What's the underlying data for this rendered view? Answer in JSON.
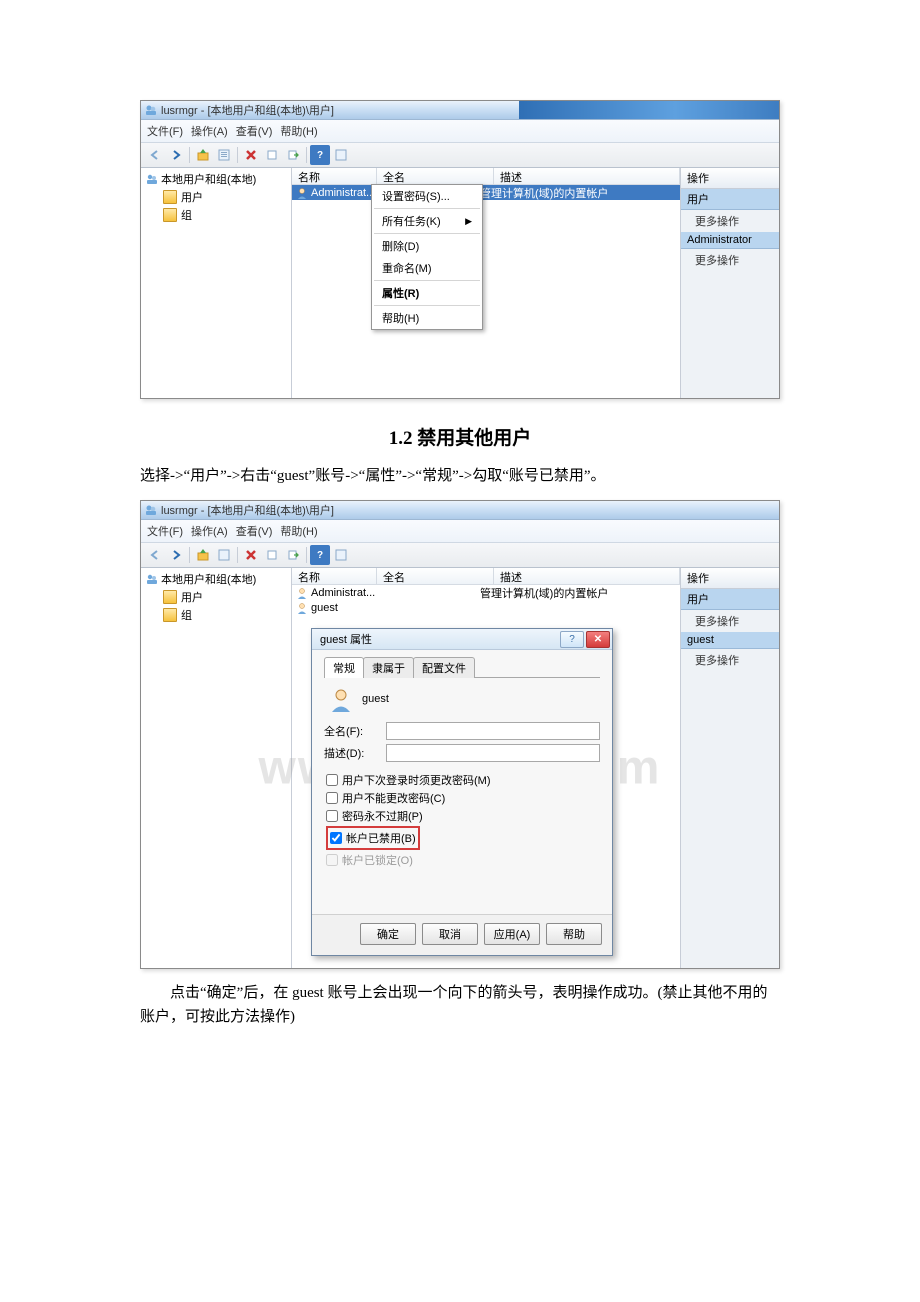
{
  "win": {
    "title": "lusrmgr - [本地用户和组(本地)\\用户]",
    "menu": {
      "file": "文件(F)",
      "action": "操作(A)",
      "view": "查看(V)",
      "help": "帮助(H)"
    },
    "tree": {
      "root": "本地用户和组(本地)",
      "users": "用户",
      "groups": "组"
    },
    "cols": {
      "name": "名称",
      "fullname": "全名",
      "desc": "描述"
    },
    "rows": {
      "admin": {
        "name": "Administrat...",
        "desc": "管理计算机(域)的内置帐户"
      },
      "guest": {
        "name": "guest",
        "desc": ""
      }
    },
    "ctx": {
      "setpwd": "设置密码(S)...",
      "alltasks": "所有任务(K)",
      "delete": "删除(D)",
      "rename": "重命名(M)",
      "properties": "属性(R)",
      "help": "帮助(H)"
    },
    "actions": {
      "header": "操作",
      "users": "用户",
      "more": "更多操作",
      "admin": "Administrator",
      "guest": "guest"
    }
  },
  "doc": {
    "section_title": "1.2 禁用其他用户",
    "line1": "选择->“用户”->右击“guest”账号->“属性”->“常规”->勾取“账号已禁用”。",
    "line2": "点击“确定”后，在 guest 账号上会出现一个向下的箭头号，表明操作成功。(禁止其他不用的账户，可按此方法操作)",
    "watermark": "www.bdocx.com"
  },
  "dlg": {
    "title": "guest 属性",
    "tabs": {
      "general": "常规",
      "member": "隶属于",
      "profile": "配置文件"
    },
    "username": "guest",
    "fields": {
      "fullname": "全名(F):",
      "desc": "描述(D):"
    },
    "checks": {
      "mustchange": "用户下次登录时须更改密码(M)",
      "cannotchange": "用户不能更改密码(C)",
      "neverexpire": "密码永不过期(P)",
      "disabled": "帐户已禁用(B)",
      "locked": "帐户已锁定(O)"
    },
    "buttons": {
      "ok": "确定",
      "cancel": "取消",
      "apply": "应用(A)",
      "help": "帮助"
    }
  }
}
